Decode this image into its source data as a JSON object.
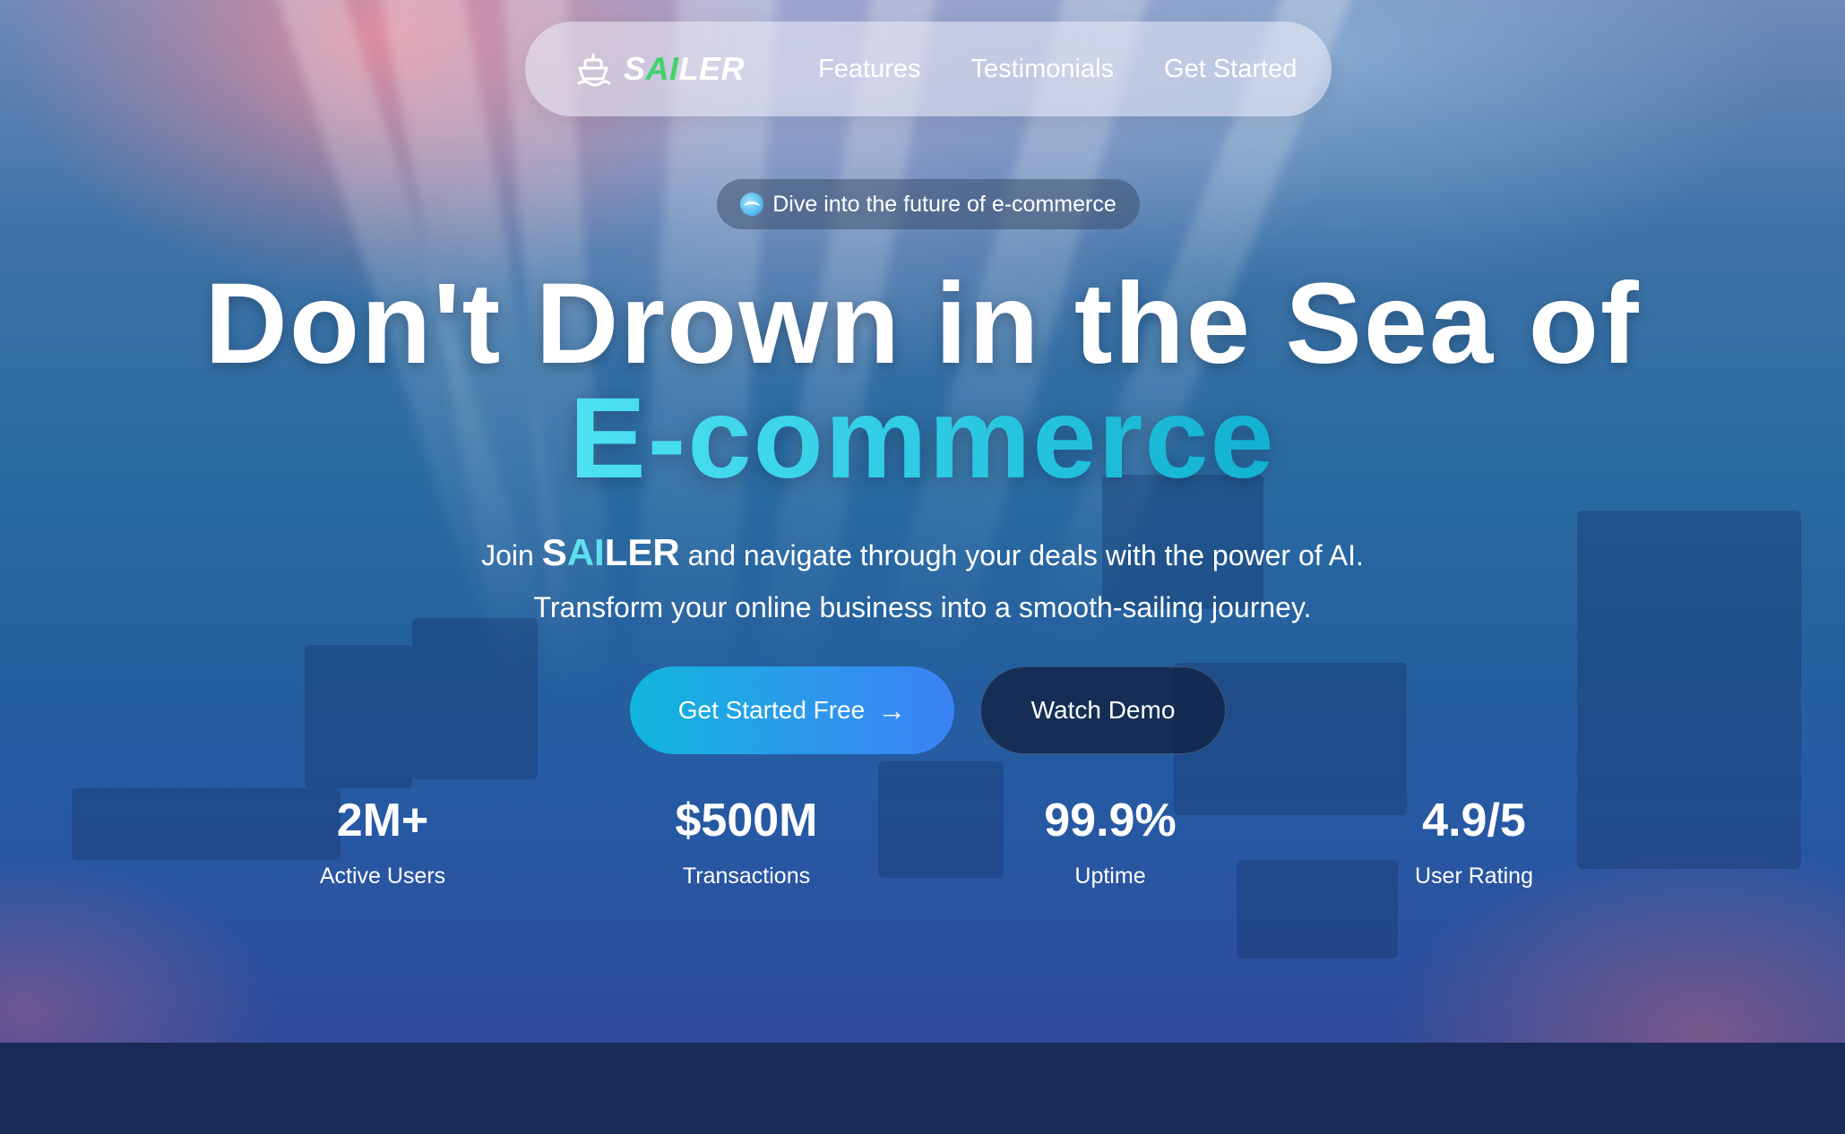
{
  "nav": {
    "logo": {
      "prefix": "S",
      "ai": "AI",
      "suffix": "LER",
      "icon": "ship-icon"
    },
    "links": [
      "Features",
      "Testimonials",
      "Get Started"
    ]
  },
  "badge": {
    "icon": "wave-icon",
    "text": "Dive into the future of e-commerce"
  },
  "hero": {
    "title_line1": "Don't Drown in the Sea of",
    "title_line2": "E-commerce",
    "subtitle_line1_before": "Join ",
    "subtitle_brand_prefix": "S",
    "subtitle_brand_ai": "AI",
    "subtitle_brand_suffix": "LER",
    "subtitle_line1_after": " and navigate through your deals with the power of AI.",
    "subtitle_line2": "Transform your online business into a smooth-sailing journey."
  },
  "buttons": {
    "primary": "Get Started Free",
    "primary_arrow": "→",
    "secondary": "Watch Demo"
  },
  "stats": [
    {
      "value": "2M+",
      "label": "Active Users"
    },
    {
      "value": "$500M",
      "label": "Transactions"
    },
    {
      "value": "99.9%",
      "label": "Uptime"
    },
    {
      "value": "4.9/5",
      "label": "User Rating"
    }
  ],
  "colors": {
    "accent_cyan": "#2fcbe4",
    "logo_ai_green": "#3fd36a",
    "primary_button_start": "#10b6dc",
    "primary_button_end": "#3b82f6",
    "bottom_band": "#1a2b58"
  }
}
